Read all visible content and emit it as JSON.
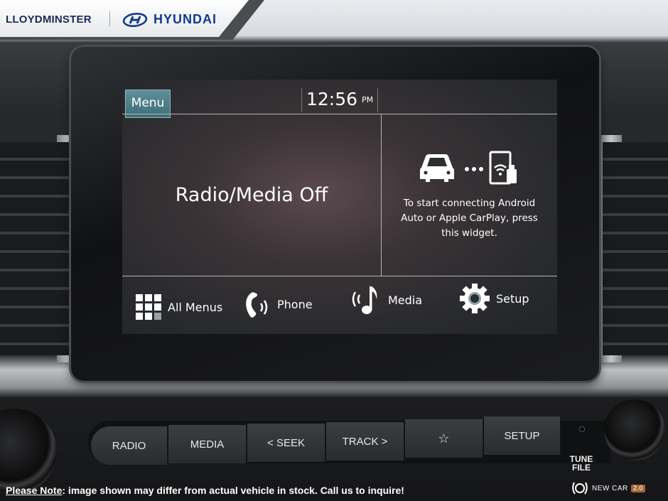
{
  "banner": {
    "dealer": "LLOYDMINSTER",
    "brand": "HYUNDAI",
    "brand_color": "#123a8c"
  },
  "screen": {
    "menu_button": "Menu",
    "clock": {
      "time": "12:56",
      "ampm": "PM"
    },
    "main_status": "Radio/Media Off",
    "connect_widget": {
      "icons": [
        "car-icon",
        "dots-icon",
        "phone-wifi-usb-icon"
      ],
      "lines": [
        "To start connecting Android",
        "Auto or Apple CarPlay, press",
        "this widget."
      ]
    },
    "nav": [
      {
        "label": "All Menus",
        "icon": "grid-icon"
      },
      {
        "label": "Phone",
        "icon": "phone-icon"
      },
      {
        "label": "Media",
        "icon": "music-note-icon"
      },
      {
        "label": "Setup",
        "icon": "gear-icon"
      }
    ],
    "accent_color": "#4f7f89"
  },
  "hardware": {
    "buttons": [
      "RADIO",
      "MEDIA",
      "< SEEK",
      "TRACK >",
      "☆",
      "SETUP"
    ],
    "tune_label_line1": "TUNE",
    "tune_label_line2": "FILE"
  },
  "footer": {
    "note_prefix": "Please Note",
    "note_text": ": image shown may differ from actual vehicle in stock. Call us to inquire!",
    "badge_text": "NEW CAR",
    "badge_version": "2.0"
  }
}
